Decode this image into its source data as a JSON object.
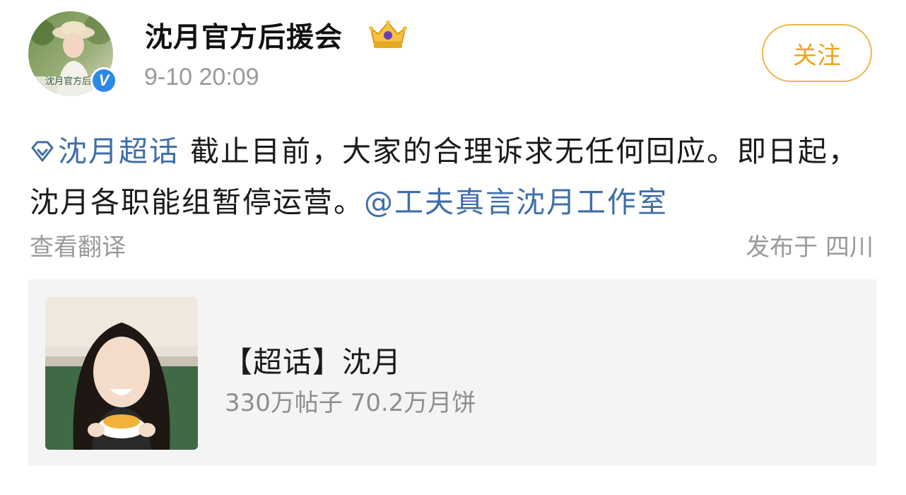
{
  "post": {
    "username": "沈月官方后援会",
    "timestamp": "9-10 20:09",
    "follow_label": "关注",
    "avatar_caption": "沈月官方后援会",
    "verified_mark": "V",
    "topic_link": "沈月超话",
    "text_part1": " 截止目前，大家的合理诉求无任何回应。即日起，沈月各职能组暂停运营。",
    "mention_link": "@工夫真言沈月工作室",
    "translate_label": "查看翻译",
    "location_label": "发布于 四川"
  },
  "card": {
    "title": "【超话】沈月",
    "stats": "330万帖子 70.2万月饼"
  },
  "colors": {
    "link": "#3e6ea8",
    "follow": "#f0a41a",
    "verified": "#2c89e8",
    "card_bg": "#f4f4f4",
    "meta_text": "#9a9a9a"
  },
  "icons": [
    "verified-badge-icon",
    "crown-badge-icon",
    "super-topic-diamond-icon"
  ]
}
